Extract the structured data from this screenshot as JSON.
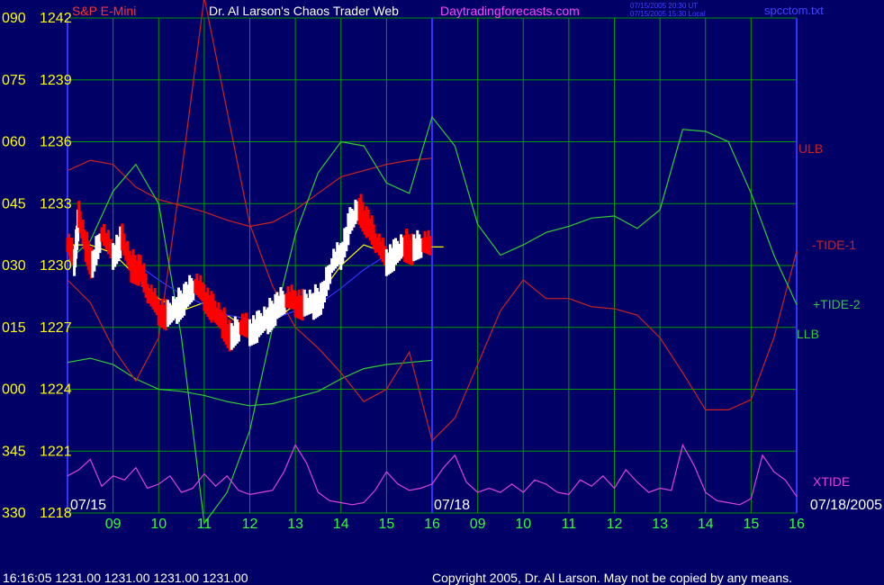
{
  "header": {
    "instrument": "S&P E-Mini",
    "site_title": "Dr. Al Larson's Chaos Trader Web",
    "site_url": "Daytradingforecasts.com",
    "stamp_line1": "07/15/2005 20:30 UT",
    "stamp_line2": "07/15/2005 15:30 Local",
    "file_name": "spcctom.txt"
  },
  "footer": {
    "status": "16:16:05  1231.00 1231.00 1231.00 1231.00",
    "copyright": "Copyright 2005, Dr. Al Larson. May not be copied by any means."
  },
  "colors": {
    "background": "#000066",
    "grid": "#009900",
    "price_up": "#ffffff",
    "price_down": "#ff0000",
    "average": "#ffff00",
    "ulb_llb": "#cc2222",
    "tide_green": "#33cc33",
    "xtide": "#dd44dd",
    "blue_curve": "#3333ff",
    "left_labels": "#ffff00",
    "time_labels": "#33ff33"
  },
  "chart_data": {
    "type": "line",
    "y_axis": {
      "angle_labels": [
        "090",
        "075",
        "060",
        "045",
        "030",
        "015",
        "000",
        "345",
        "330"
      ],
      "price_labels": [
        "1242",
        "1239",
        "1236",
        "1233",
        "1230",
        "1227",
        "1224",
        "1221",
        "1218"
      ],
      "ylim": [
        1218,
        1242
      ]
    },
    "x_axis": {
      "date_labels": [
        "07/15",
        "07/18",
        "07/18/2005"
      ],
      "hour_labels": [
        "09",
        "10",
        "11",
        "12",
        "13",
        "14",
        "15",
        "16",
        "09",
        "10",
        "11",
        "12",
        "13",
        "14",
        "15",
        "16"
      ]
    },
    "series_labels": [
      "ULB",
      "-TIDE-1",
      "+TIDE-2",
      "LLB",
      "XTIDE"
    ],
    "series": [
      {
        "name": "ULB",
        "x": [
          0,
          0.5,
          1,
          1.5,
          2,
          2.5,
          3,
          3.5,
          4,
          4.5,
          5,
          5.5,
          6,
          6.5,
          7,
          7.5,
          8
        ],
        "y": [
          1234.6,
          1235.1,
          1234.9,
          1233.8,
          1233.2,
          1232.9,
          1232.6,
          1232.2,
          1231.9,
          1232.1,
          1232.7,
          1233.5,
          1234.3,
          1234.6,
          1234.9,
          1235.1,
          1235.2
        ]
      },
      {
        "name": "LLB",
        "x": [
          0,
          0.5,
          1,
          1.5,
          2,
          2.5,
          3,
          3.5,
          4,
          4.5,
          5,
          5.5,
          6,
          6.5,
          7,
          7.5,
          8
        ],
        "y": [
          1225.3,
          1225.5,
          1225.2,
          1224.5,
          1224.0,
          1223.9,
          1223.7,
          1223.4,
          1223.2,
          1223.3,
          1223.6,
          1223.9,
          1224.5,
          1225.0,
          1225.2,
          1225.3,
          1225.4
        ]
      },
      {
        "name": "-TIDE-1",
        "x": [
          0,
          0.5,
          1,
          1.5,
          2,
          2.5,
          3,
          3.5,
          4,
          4.5,
          5,
          5.5,
          6,
          6.5,
          7,
          7.5,
          8,
          8.5,
          9,
          9.5,
          10,
          10.5,
          11,
          11.5,
          12,
          12.5,
          13,
          13.5,
          14,
          14.5,
          15,
          15.5,
          16
        ],
        "y": [
          1229.3,
          1228.2,
          1226.0,
          1224.4,
          1226.5,
          1234.5,
          1243.0,
          1237.5,
          1232.0,
          1229.0,
          1227.0,
          1226.0,
          1224.8,
          1223.4,
          1224.0,
          1225.8,
          1221.5,
          1222.6,
          1225.2,
          1227.8,
          1229.3,
          1228.4,
          1228.4,
          1228.0,
          1227.9,
          1227.6,
          1226.5,
          1224.8,
          1223.0,
          1223.0,
          1223.5,
          1226.5,
          1230.7
        ]
      },
      {
        "name": "+TIDE-2",
        "x": [
          0,
          0.5,
          1,
          1.5,
          2,
          2.5,
          3,
          3.5,
          4,
          4.5,
          5,
          5.5,
          6,
          6.5,
          7,
          7.5,
          8,
          8.5,
          9,
          9.5,
          10,
          10.5,
          11,
          11.5,
          12,
          12.5,
          13,
          13.5,
          14,
          14.5,
          15,
          15.5,
          16
        ],
        "y": [
          1230.2,
          1231.2,
          1233.6,
          1234.9,
          1233.0,
          1226.5,
          1217.5,
          1219.0,
          1222.0,
          1227.0,
          1231.5,
          1234.5,
          1236.0,
          1235.8,
          1234.0,
          1233.5,
          1237.2,
          1235.8,
          1232.0,
          1230.5,
          1231.0,
          1231.6,
          1231.9,
          1232.3,
          1232.4,
          1231.8,
          1232.7,
          1236.6,
          1236.5,
          1236.0,
          1233.5,
          1230.5,
          1228.1
        ]
      },
      {
        "name": "XTIDE",
        "x": [
          0,
          0.25,
          0.5,
          0.75,
          1,
          1.25,
          1.5,
          1.75,
          2,
          2.25,
          2.5,
          2.75,
          3,
          3.25,
          3.5,
          3.75,
          4,
          4.25,
          4.5,
          4.75,
          5,
          5.25,
          5.5,
          5.75,
          6,
          6.25,
          6.5,
          6.75,
          7,
          7.25,
          7.5,
          7.75,
          8,
          8.25,
          8.5,
          8.75,
          9,
          9.25,
          9.5,
          9.75,
          10,
          10.25,
          10.5,
          10.75,
          11,
          11.25,
          11.5,
          11.75,
          12,
          12.25,
          12.5,
          12.75,
          13,
          13.25,
          13.5,
          13.75,
          14,
          14.25,
          14.5,
          14.75,
          15,
          15.25,
          15.5,
          15.75,
          16
        ],
        "y": [
          1219.8,
          1220.1,
          1220.6,
          1219.3,
          1219.8,
          1219.6,
          1220.2,
          1219.2,
          1219.4,
          1219.8,
          1219.0,
          1219.2,
          1219.9,
          1219.3,
          1219.8,
          1219.1,
          1218.9,
          1219.0,
          1219.1,
          1220.0,
          1221.3,
          1220.4,
          1219.0,
          1218.6,
          1218.5,
          1218.4,
          1218.5,
          1219.1,
          1220.0,
          1219.4,
          1219.1,
          1219.2,
          1219.4,
          1220.2,
          1220.8,
          1219.5,
          1219.0,
          1219.2,
          1219.0,
          1219.4,
          1219.0,
          1219.6,
          1219.4,
          1219.0,
          1218.9,
          1219.6,
          1219.3,
          1219.8,
          1219.2,
          1220.1,
          1219.5,
          1219.0,
          1219.2,
          1219.1,
          1221.3,
          1220.3,
          1219.0,
          1218.6,
          1218.5,
          1218.4,
          1218.7,
          1220.8,
          1220.0,
          1219.6,
          1218.8
        ]
      },
      {
        "name": "price",
        "x": [
          0,
          0.15,
          0.25,
          0.4,
          0.55,
          0.75,
          1,
          1.2,
          1.4,
          1.6,
          1.8,
          2,
          2.2,
          2.4,
          2.6,
          2.8,
          3,
          3.2,
          3.4,
          3.6,
          3.8,
          4,
          4.2,
          4.4,
          4.6,
          4.8,
          5,
          5.2,
          5.4,
          5.6,
          5.8,
          6,
          6.2,
          6.4,
          6.6,
          6.8,
          7,
          7.2,
          7.4,
          7.6,
          7.8,
          8
        ],
        "y": [
          1231.0,
          1230.2,
          1232.3,
          1231.0,
          1230.0,
          1231.5,
          1230.5,
          1231.2,
          1230.0,
          1229.8,
          1228.5,
          1227.8,
          1227.5,
          1228.0,
          1228.5,
          1229.0,
          1228.5,
          1227.8,
          1227.3,
          1226.5,
          1227.0,
          1226.8,
          1227.0,
          1227.5,
          1228.0,
          1228.3,
          1228.2,
          1228.0,
          1228.2,
          1228.5,
          1230.0,
          1230.5,
          1232.0,
          1232.8,
          1232.0,
          1231.0,
          1230.2,
          1230.5,
          1231.0,
          1230.8,
          1231.0,
          1230.8
        ]
      },
      {
        "name": "average",
        "x": [
          0,
          0.5,
          1,
          1.5,
          2,
          2.5,
          3,
          3.5,
          4,
          4.5,
          5,
          5.5,
          6,
          6.5,
          7,
          7.5,
          8,
          8.25
        ],
        "y": [
          1231.0,
          1231.0,
          1230.6,
          1229.5,
          1228.4,
          1227.8,
          1228.2,
          1227.6,
          1226.8,
          1227.3,
          1228.1,
          1228.5,
          1230.0,
          1231.0,
          1230.6,
          1230.7,
          1230.9,
          1230.9
        ]
      },
      {
        "name": "blue",
        "x": [
          1.5,
          2,
          2.5,
          3,
          3.5,
          4,
          4.5,
          5,
          5.5,
          6,
          6.5,
          7,
          7.5
        ],
        "y": [
          1230.1,
          1229.3,
          1228.6,
          1228.1,
          1227.6,
          1227.4,
          1227.4,
          1227.8,
          1228.1,
          1228.9,
          1229.8,
          1230.5,
          1231.2
        ]
      }
    ]
  }
}
